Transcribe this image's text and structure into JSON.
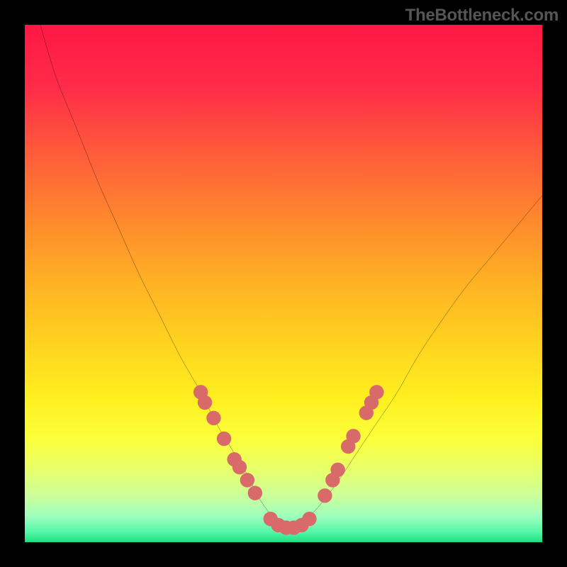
{
  "watermark": "TheBottleneck.com",
  "chart_data": {
    "type": "line",
    "title": "",
    "xlabel": "",
    "ylabel": "",
    "xlim": [
      0,
      100
    ],
    "ylim": [
      0,
      100
    ],
    "gradient_stops": [
      {
        "offset": 0.0,
        "color": "#ff1744"
      },
      {
        "offset": 0.12,
        "color": "#ff2c48"
      },
      {
        "offset": 0.25,
        "color": "#ff5c3a"
      },
      {
        "offset": 0.38,
        "color": "#ff8a2d"
      },
      {
        "offset": 0.5,
        "color": "#ffb224"
      },
      {
        "offset": 0.62,
        "color": "#ffd41f"
      },
      {
        "offset": 0.72,
        "color": "#ffef1f"
      },
      {
        "offset": 0.8,
        "color": "#fbff3a"
      },
      {
        "offset": 0.86,
        "color": "#e8ff6a"
      },
      {
        "offset": 0.91,
        "color": "#ccff9a"
      },
      {
        "offset": 0.95,
        "color": "#9dffbe"
      },
      {
        "offset": 0.98,
        "color": "#55f7a8"
      },
      {
        "offset": 1.0,
        "color": "#1be07f"
      }
    ],
    "series": [
      {
        "name": "bottleneck-curve",
        "x": [
          3,
          6,
          10,
          14,
          18,
          22,
          26,
          30,
          34,
          37,
          40,
          43,
          45,
          47,
          49,
          51,
          53,
          56,
          60,
          64,
          68,
          72,
          76,
          80,
          85,
          90,
          95,
          100
        ],
        "y": [
          100,
          90,
          80,
          70,
          61,
          52,
          44,
          36,
          29,
          23,
          18,
          13,
          9,
          6,
          3.5,
          2.5,
          3.5,
          6,
          11,
          17,
          23,
          29,
          36,
          42,
          49,
          55,
          61,
          67
        ]
      }
    ],
    "marker_clusters": [
      {
        "name": "left-cluster",
        "points": [
          {
            "x": 34.0,
            "y": 29.0
          },
          {
            "x": 34.8,
            "y": 27.0
          },
          {
            "x": 36.5,
            "y": 24.0
          },
          {
            "x": 38.5,
            "y": 20.0
          },
          {
            "x": 40.5,
            "y": 16.0
          },
          {
            "x": 41.5,
            "y": 14.5
          },
          {
            "x": 43.0,
            "y": 12.0
          },
          {
            "x": 44.5,
            "y": 9.5
          }
        ]
      },
      {
        "name": "bottom-cluster",
        "points": [
          {
            "x": 47.5,
            "y": 4.5
          },
          {
            "x": 49.0,
            "y": 3.3
          },
          {
            "x": 50.5,
            "y": 2.8
          },
          {
            "x": 52.0,
            "y": 2.8
          },
          {
            "x": 53.5,
            "y": 3.3
          },
          {
            "x": 55.0,
            "y": 4.5
          }
        ]
      },
      {
        "name": "right-cluster",
        "points": [
          {
            "x": 58.0,
            "y": 9.0
          },
          {
            "x": 59.5,
            "y": 12.0
          },
          {
            "x": 60.5,
            "y": 14.0
          },
          {
            "x": 62.5,
            "y": 18.5
          },
          {
            "x": 63.5,
            "y": 20.5
          },
          {
            "x": 66.0,
            "y": 25.0
          },
          {
            "x": 67.0,
            "y": 27.0
          },
          {
            "x": 68.0,
            "y": 29.0
          }
        ]
      }
    ],
    "marker_style": {
      "fill": "#d96a6a",
      "radius": 1.4
    },
    "line_style": {
      "stroke": "#000000",
      "width": 0.35
    }
  }
}
